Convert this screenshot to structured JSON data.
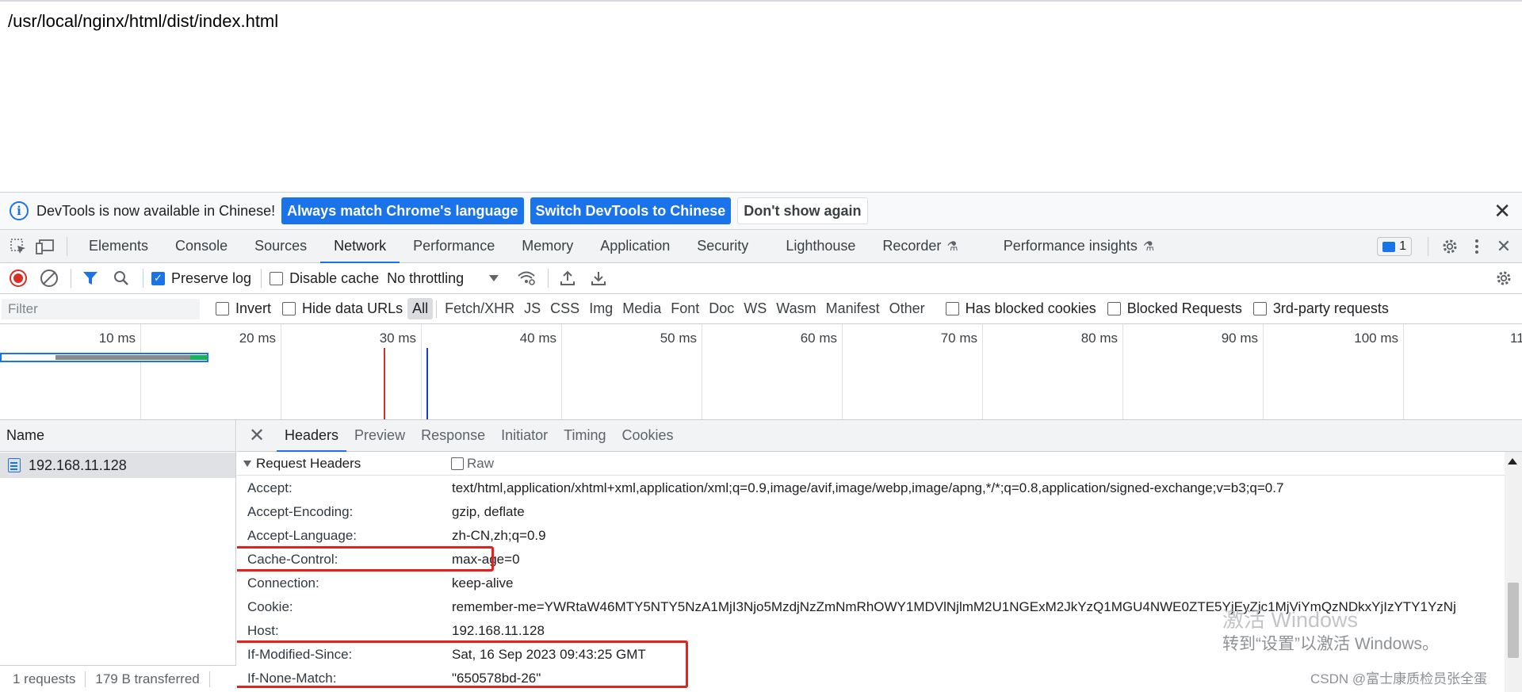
{
  "page": {
    "path_text": "/usr/local/nginx/html/dist/index.html"
  },
  "infobar": {
    "message": "DevTools is now available in Chinese!",
    "btn_match": "Always match Chrome's language",
    "btn_switch": "Switch DevTools to Chinese",
    "btn_dont_show": "Don't show again"
  },
  "tabs": {
    "elements": "Elements",
    "console": "Console",
    "sources": "Sources",
    "network": "Network",
    "performance": "Performance",
    "memory": "Memory",
    "application": "Application",
    "security": "Security",
    "lighthouse": "Lighthouse",
    "recorder": "Recorder",
    "perf_insights": "Performance insights",
    "issues_count": "1"
  },
  "network_toolbar": {
    "preserve_log": "Preserve log",
    "preserve_log_checked": true,
    "disable_cache": "Disable cache",
    "disable_cache_checked": false,
    "throttling": "No throttling"
  },
  "filter_bar": {
    "placeholder": "Filter",
    "invert": "Invert",
    "hide_data_urls": "Hide data URLs",
    "types": [
      "All",
      "Fetch/XHR",
      "JS",
      "CSS",
      "Img",
      "Media",
      "Font",
      "Doc",
      "WS",
      "Wasm",
      "Manifest",
      "Other"
    ],
    "active_type": "All",
    "has_blocked_cookies": "Has blocked cookies",
    "blocked_requests": "Blocked Requests",
    "third_party": "3rd-party requests"
  },
  "overview": {
    "tick_labels": [
      "10 ms",
      "20 ms",
      "30 ms",
      "40 ms",
      "50 ms",
      "60 ms",
      "70 ms",
      "80 ms",
      "90 ms",
      "100 ms",
      "110"
    ],
    "request_end_ms": 15.8,
    "dom_content_loaded_ms": 27.4,
    "load_ms": 30.4
  },
  "requests": {
    "column_name": "Name",
    "items": [
      {
        "name": "192.168.11.128"
      }
    ],
    "footer_count": "1 requests",
    "footer_transferred": "179 B transferred"
  },
  "details": {
    "tabs": [
      "Headers",
      "Preview",
      "Response",
      "Initiator",
      "Timing",
      "Cookies"
    ],
    "active_tab": "Headers",
    "section_title": "Request Headers",
    "raw_label": "Raw",
    "headers": [
      {
        "name": "Accept:",
        "value": "text/html,application/xhtml+xml,application/xml;q=0.9,image/avif,image/webp,image/apng,*/*;q=0.8,application/signed-exchange;v=b3;q=0.7"
      },
      {
        "name": "Accept-Encoding:",
        "value": "gzip, deflate"
      },
      {
        "name": "Accept-Language:",
        "value": "zh-CN,zh;q=0.9"
      },
      {
        "name": "Cache-Control:",
        "value": "max-age=0"
      },
      {
        "name": "Connection:",
        "value": "keep-alive"
      },
      {
        "name": "Cookie:",
        "value": "remember-me=YWRtaW46MTY5NTY5NzA1MjI3Njo5MzdjNzZmNmRhOWY1MDVlNjlmM2U1NGExM2JkYzQ1MGU4NWE0ZTE5YjEyZjc1MjViYmQzNDkxYjIzYTY1YzNj"
      },
      {
        "name": "Host:",
        "value": "192.168.11.128"
      },
      {
        "name": "If-Modified-Since:",
        "value": "Sat, 16 Sep 2023 09:43:25 GMT"
      },
      {
        "name": "If-None-Match:",
        "value": "\"650578bd-26\""
      }
    ]
  },
  "watermark": {
    "line1": "激活 Windows",
    "line2": "转到“设置”以激活 Windows。",
    "credit": "CSDN @富士康质检员张全蛋"
  },
  "colors": {
    "accent": "#1a73e8",
    "highlight_box": "#e8201c",
    "record": "#d93025"
  }
}
